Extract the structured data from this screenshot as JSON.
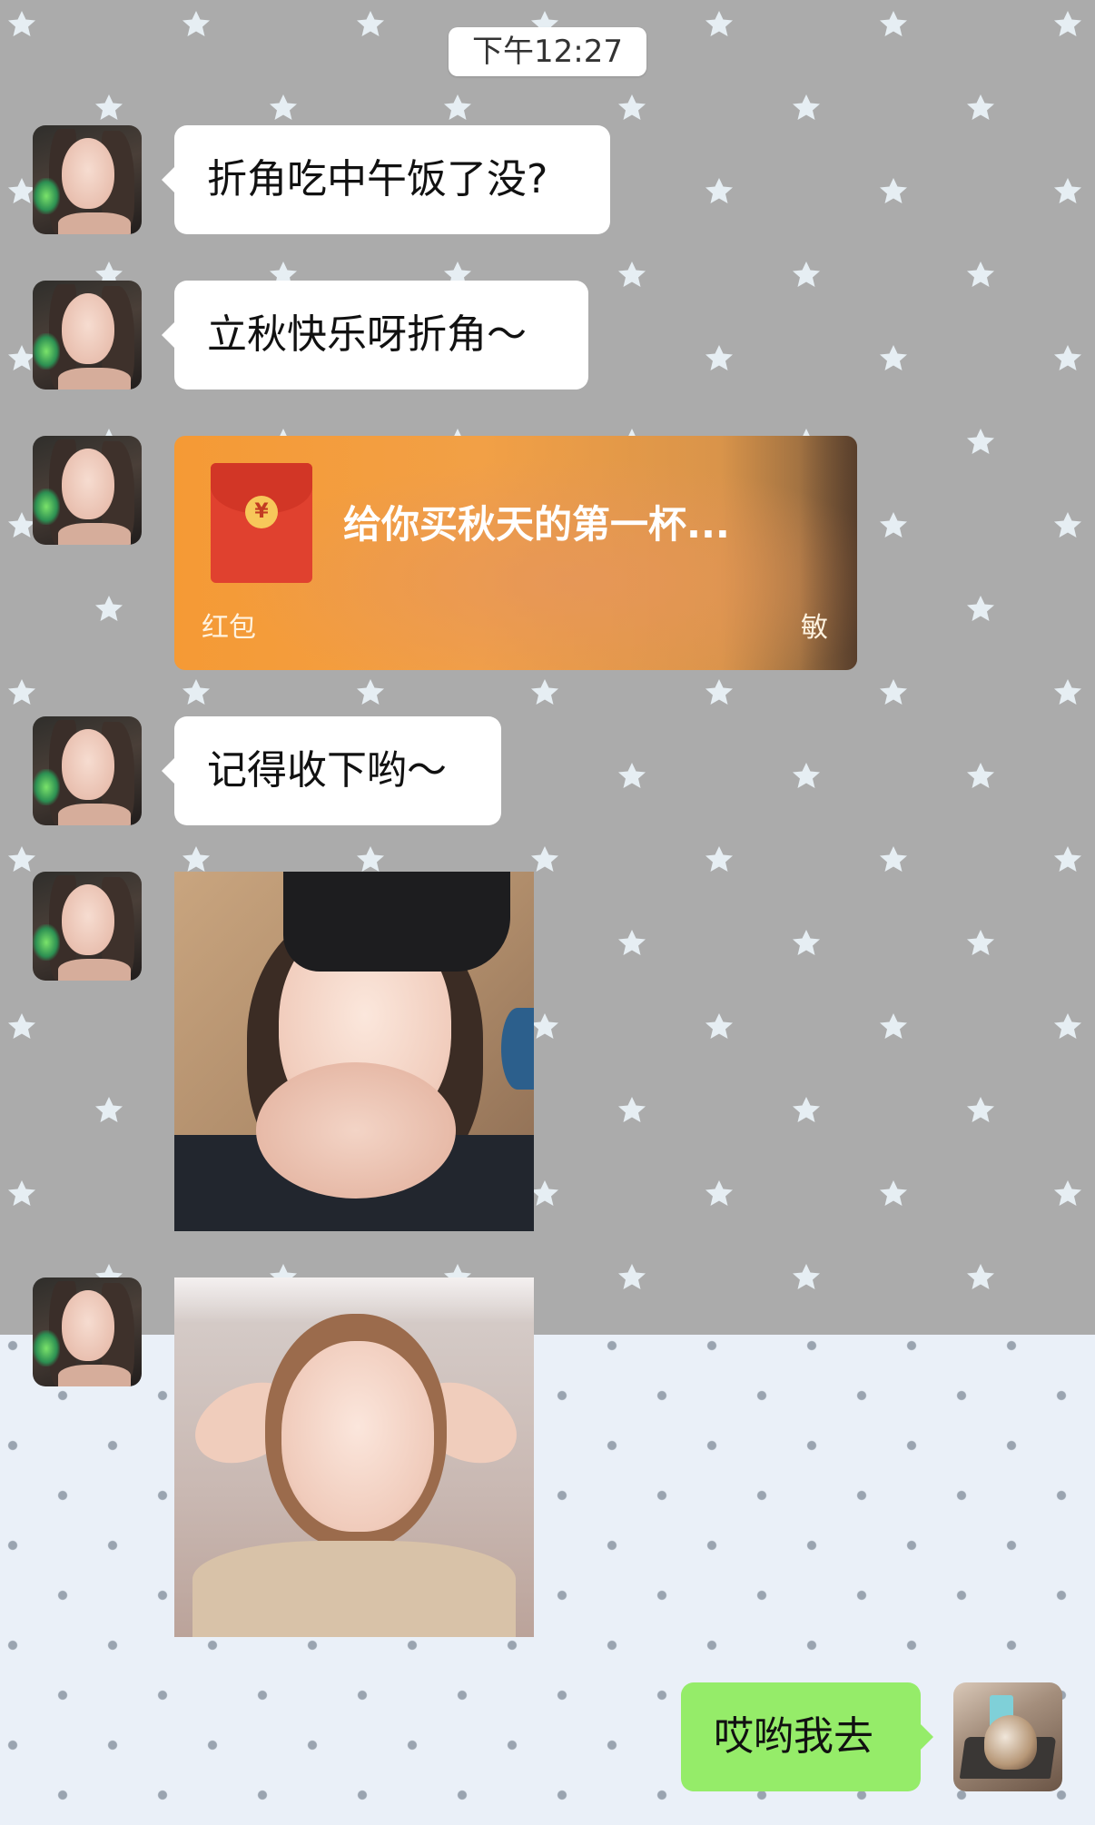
{
  "chat": {
    "timestamp": "下午12:27",
    "messages": [
      {
        "type": "text",
        "side": "left",
        "text": "折角吃中午饭了没?"
      },
      {
        "type": "text",
        "side": "left",
        "text": "立秋快乐呀折角～"
      },
      {
        "type": "red_packet",
        "side": "left",
        "title": "给你买秋天的第一杯...",
        "label": "红包",
        "sender": "敏",
        "coin_symbol": "¥"
      },
      {
        "type": "text",
        "side": "left",
        "text": "记得收下哟～"
      },
      {
        "type": "image",
        "side": "left",
        "icon": "photo-selfie-heart-hands"
      },
      {
        "type": "image",
        "side": "left",
        "icon": "photo-selfie-hands-behind-head"
      },
      {
        "type": "text",
        "side": "right",
        "text": "哎哟我去"
      }
    ]
  },
  "colors": {
    "background_top": "#ababab",
    "background_bottom": "#eaf0f8",
    "bubble_incoming": "#ffffff",
    "bubble_outgoing": "#95ec69",
    "red_packet": "#f59a35"
  }
}
